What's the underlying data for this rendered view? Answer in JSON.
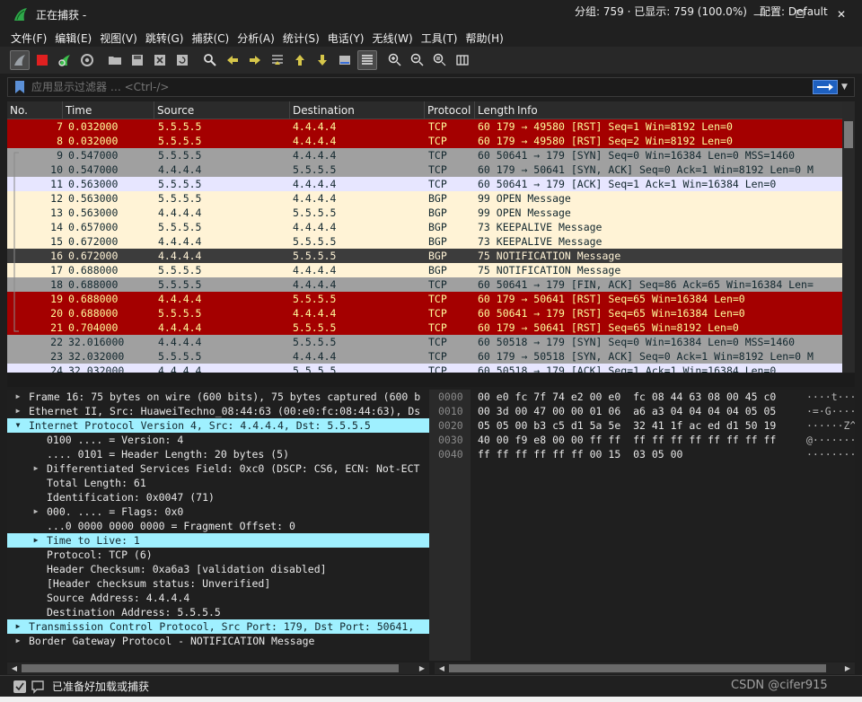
{
  "window": {
    "title": "正在捕获 -",
    "minimize": "—",
    "maximize": "☐",
    "close": "✕"
  },
  "menu": [
    "文件(F)",
    "编辑(E)",
    "视图(V)",
    "跳转(G)",
    "捕获(C)",
    "分析(A)",
    "统计(S)",
    "电话(Y)",
    "无线(W)",
    "工具(T)",
    "帮助(H)"
  ],
  "toolbar_icons": [
    "shark-fin-icon",
    "stop-capture-icon",
    "restart-capture-icon",
    "capture-options-icon",
    "open-file-icon",
    "save-file-icon",
    "close-file-icon",
    "reload-file-icon",
    "find-packet-icon",
    "go-back-icon",
    "go-forward-icon",
    "go-to-packet-icon",
    "go-first-icon",
    "go-last-icon",
    "auto-scroll-icon",
    "colorize-icon",
    "zoom-in-icon",
    "zoom-out-icon",
    "zoom-normal-icon",
    "resize-columns-icon"
  ],
  "filter": {
    "placeholder": "应用显示过滤器 … <Ctrl-/>",
    "value": ""
  },
  "packet_list": {
    "columns": [
      "No.",
      "Time",
      "Source",
      "Destination",
      "Protocol",
      "Length",
      "Info"
    ],
    "rows": [
      {
        "no": "7",
        "time": "0.032000",
        "src": "5.5.5.5",
        "dst": "4.4.4.4",
        "proto": "TCP",
        "info": "60 179 → 49580 [RST] Seq=1 Win=8192 Len=0",
        "style": "red"
      },
      {
        "no": "8",
        "time": "0.032000",
        "src": "5.5.5.5",
        "dst": "4.4.4.4",
        "proto": "TCP",
        "info": "60 179 → 49580 [RST] Seq=2 Win=8192 Len=0",
        "style": "red"
      },
      {
        "no": "9",
        "time": "0.547000",
        "src": "5.5.5.5",
        "dst": "4.4.4.4",
        "proto": "TCP",
        "info": "60 50641 → 179 [SYN] Seq=0 Win=16384 Len=0 MSS=1460",
        "style": "gray"
      },
      {
        "no": "10",
        "time": "0.547000",
        "src": "4.4.4.4",
        "dst": "5.5.5.5",
        "proto": "TCP",
        "info": "60 179 → 50641 [SYN, ACK] Seq=0 Ack=1 Win=8192 Len=0 M",
        "style": "gray"
      },
      {
        "no": "11",
        "time": "0.563000",
        "src": "5.5.5.5",
        "dst": "4.4.4.4",
        "proto": "TCP",
        "info": "60 50641 → 179 [ACK] Seq=1 Ack=1 Win=16384 Len=0",
        "style": "lav"
      },
      {
        "no": "12",
        "time": "0.563000",
        "src": "5.5.5.5",
        "dst": "4.4.4.4",
        "proto": "BGP",
        "info": "99 OPEN Message",
        "style": "cream"
      },
      {
        "no": "13",
        "time": "0.563000",
        "src": "4.4.4.4",
        "dst": "5.5.5.5",
        "proto": "BGP",
        "info": "99 OPEN Message",
        "style": "cream"
      },
      {
        "no": "14",
        "time": "0.657000",
        "src": "5.5.5.5",
        "dst": "4.4.4.4",
        "proto": "BGP",
        "info": "73 KEEPALIVE Message",
        "style": "cream"
      },
      {
        "no": "15",
        "time": "0.672000",
        "src": "4.4.4.4",
        "dst": "5.5.5.5",
        "proto": "BGP",
        "info": "73 KEEPALIVE Message",
        "style": "cream"
      },
      {
        "no": "16",
        "time": "0.672000",
        "src": "4.4.4.4",
        "dst": "5.5.5.5",
        "proto": "BGP",
        "info": "75 NOTIFICATION Message",
        "style": "sel"
      },
      {
        "no": "17",
        "time": "0.688000",
        "src": "5.5.5.5",
        "dst": "4.4.4.4",
        "proto": "BGP",
        "info": "75 NOTIFICATION Message",
        "style": "cream"
      },
      {
        "no": "18",
        "time": "0.688000",
        "src": "5.5.5.5",
        "dst": "4.4.4.4",
        "proto": "TCP",
        "info": "60 50641 → 179 [FIN, ACK] Seq=86 Ack=65 Win=16384 Len=",
        "style": "gray"
      },
      {
        "no": "19",
        "time": "0.688000",
        "src": "4.4.4.4",
        "dst": "5.5.5.5",
        "proto": "TCP",
        "info": "60 179 → 50641 [RST] Seq=65 Win=16384 Len=0",
        "style": "red"
      },
      {
        "no": "20",
        "time": "0.688000",
        "src": "5.5.5.5",
        "dst": "4.4.4.4",
        "proto": "TCP",
        "info": "60 50641 → 179 [RST] Seq=65 Win=16384 Len=0",
        "style": "red"
      },
      {
        "no": "21",
        "time": "0.704000",
        "src": "4.4.4.4",
        "dst": "5.5.5.5",
        "proto": "TCP",
        "info": "60 179 → 50641 [RST] Seq=65 Win=8192 Len=0",
        "style": "red"
      },
      {
        "no": "22",
        "time": "32.016000",
        "src": "4.4.4.4",
        "dst": "5.5.5.5",
        "proto": "TCP",
        "info": "60 50518 → 179 [SYN] Seq=0 Win=16384 Len=0 MSS=1460",
        "style": "gray"
      },
      {
        "no": "23",
        "time": "32.032000",
        "src": "5.5.5.5",
        "dst": "4.4.4.4",
        "proto": "TCP",
        "info": "60 179 → 50518 [SYN, ACK] Seq=0 Ack=1 Win=8192 Len=0 M",
        "style": "gray"
      },
      {
        "no": "24",
        "time": "32.032000",
        "src": "4.4.4.4",
        "dst": "5.5.5.5",
        "proto": "TCP",
        "info": "60 50518 → 179 [ACK] Seq=1 Ack=1 Win=16384 Len=0",
        "style": "lav"
      }
    ]
  },
  "details": [
    {
      "arrow": "right",
      "indent": 0,
      "text": "Frame 16: 75 bytes on wire (600 bits), 75 bytes captured (600 b",
      "hl": ""
    },
    {
      "arrow": "right",
      "indent": 0,
      "text": "Ethernet II, Src: HuaweiTechno_08:44:63 (00:e0:fc:08:44:63), Ds",
      "hl": ""
    },
    {
      "arrow": "down",
      "indent": 0,
      "text": "Internet Protocol Version 4, Src: 4.4.4.4, Dst: 5.5.5.5",
      "hl": "full"
    },
    {
      "arrow": "",
      "indent": 1,
      "text": "0100 .... = Version: 4",
      "hl": ""
    },
    {
      "arrow": "",
      "indent": 1,
      "text": ".... 0101 = Header Length: 20 bytes (5)",
      "hl": ""
    },
    {
      "arrow": "right",
      "indent": 1,
      "text": "Differentiated Services Field: 0xc0 (DSCP: CS6, ECN: Not-ECT",
      "hl": ""
    },
    {
      "arrow": "",
      "indent": 1,
      "text": "Total Length: 61",
      "hl": ""
    },
    {
      "arrow": "",
      "indent": 1,
      "text": "Identification: 0x0047 (71)",
      "hl": ""
    },
    {
      "arrow": "right",
      "indent": 1,
      "text": "000. .... = Flags: 0x0",
      "hl": ""
    },
    {
      "arrow": "",
      "indent": 1,
      "text": "...0 0000 0000 0000 = Fragment Offset: 0",
      "hl": ""
    },
    {
      "arrow": "right",
      "indent": 1,
      "text": "Time to Live: 1",
      "hl": "full"
    },
    {
      "arrow": "",
      "indent": 1,
      "text": "Protocol: TCP (6)",
      "hl": ""
    },
    {
      "arrow": "",
      "indent": 1,
      "text": "Header Checksum: 0xa6a3 [validation disabled]",
      "hl": ""
    },
    {
      "arrow": "",
      "indent": 1,
      "text": "[Header checksum status: Unverified]",
      "hl": ""
    },
    {
      "arrow": "",
      "indent": 1,
      "text": "Source Address: 4.4.4.4",
      "hl": ""
    },
    {
      "arrow": "",
      "indent": 1,
      "text": "Destination Address: 5.5.5.5",
      "hl": ""
    },
    {
      "arrow": "right",
      "indent": 0,
      "text": "Transmission Control Protocol, Src Port: 179, Dst Port: 50641,",
      "hl": "full"
    },
    {
      "arrow": "right",
      "indent": 0,
      "text": "Border Gateway Protocol - NOTIFICATION Message",
      "hl": ""
    }
  ],
  "bytes": [
    {
      "offset": "0000",
      "hex": "00 e0 fc 7f 74 e2 00 e0  fc 08 44 63 08 00 45 c0",
      "ascii": "····t··· ··Dc··E·"
    },
    {
      "offset": "0010",
      "hex": "00 3d 00 47 00 00 01 06  a6 a3 04 04 04 04 05 05",
      "ascii": "·=·G···· ········"
    },
    {
      "offset": "0020",
      "hex": "05 05 00 b3 c5 d1 5a 5e  32 41 1f ac ed d1 50 19",
      "ascii": "······Z^ 2A····P·"
    },
    {
      "offset": "0030",
      "hex": "40 00 f9 e8 00 00 ff ff  ff ff ff ff ff ff ff ff",
      "ascii": "@······· ········"
    },
    {
      "offset": "0040",
      "hex": "ff ff ff ff ff ff 00 15  03 05 00",
      "ascii": "········ ···"
    }
  ],
  "status": {
    "left": "已准备好加载或捕获",
    "packets": "分组: 759 · 已显示: 759 (100.0%)",
    "profile": "配置: Default"
  },
  "watermark": "CSDN @cifer915",
  "colors": {
    "red_row": "#a40000",
    "gray_row": "#a0a0a0",
    "lavender_row": "#e7e6ff",
    "cream_row": "#fff3d6",
    "selected_row": "#3c3c3c",
    "highlight": "#9ff0ff"
  }
}
